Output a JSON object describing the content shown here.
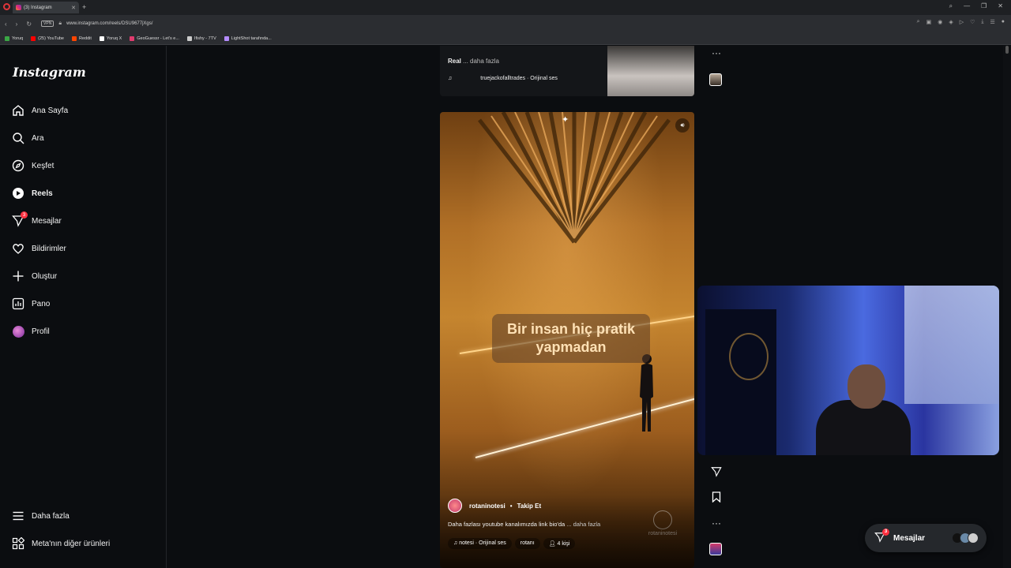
{
  "browser": {
    "tab_title": "(3) Instagram",
    "url": "www.instagram.com/reels/DSU9677jXgs/",
    "vpn_label": "VPN",
    "bookmarks": [
      {
        "label": "Yoruq",
        "color": "#3aa745"
      },
      {
        "label": "(25) YouTube",
        "color": "#ff0000"
      },
      {
        "label": "Reddit",
        "color": "#ff4500"
      },
      {
        "label": "Yoruq X",
        "color": "#ffffff"
      },
      {
        "label": "GeoGuessr - Let's e...",
        "color": "#e03b6e"
      },
      {
        "label": "Ifishy - 7TV",
        "color": "#cccccc"
      },
      {
        "label": "LightShot tarafında...",
        "color": "#b58cff"
      }
    ]
  },
  "sidebar": {
    "logo": "Instagram",
    "items": [
      {
        "label": "Ana Sayfa",
        "icon": "home-icon"
      },
      {
        "label": "Ara",
        "icon": "search-icon"
      },
      {
        "label": "Keşfet",
        "icon": "compass-icon"
      },
      {
        "label": "Reels",
        "icon": "reels-icon",
        "active": true
      },
      {
        "label": "Mesajlar",
        "icon": "messenger-icon",
        "badge": "3"
      },
      {
        "label": "Bildirimler",
        "icon": "heart-icon"
      },
      {
        "label": "Oluştur",
        "icon": "plus-icon"
      },
      {
        "label": "Pano",
        "icon": "dashboard-icon"
      },
      {
        "label": "Profil",
        "icon": "avatar-icon"
      }
    ],
    "bottom": [
      {
        "label": "Daha fazla",
        "icon": "menu-icon"
      },
      {
        "label": "Meta'nın diğer ürünleri",
        "icon": "grid-icon"
      }
    ]
  },
  "previous_reel": {
    "caption_user": "Real",
    "caption_more": "... daha fazla",
    "audio": "truejackofalltrades · Orijinal ses"
  },
  "reel": {
    "overlay_text": "Bir insan hiç pratik yapmadan",
    "account": "rotaninotesi",
    "follow": "Takip Et",
    "description": "Daha fazlası youtube kanalımızda link bio'da",
    "description_more": "... daha fazla",
    "audio_chip": "notesi · Orijinal ses",
    "user_chip": "rotanı",
    "people_chip": "4 kişi",
    "watermark": "rotaninotesi"
  },
  "messages_pill": {
    "label": "Mesajlar",
    "badge": "3"
  },
  "colors": {
    "background": "#0b0d10",
    "notification": "#ff3040"
  }
}
